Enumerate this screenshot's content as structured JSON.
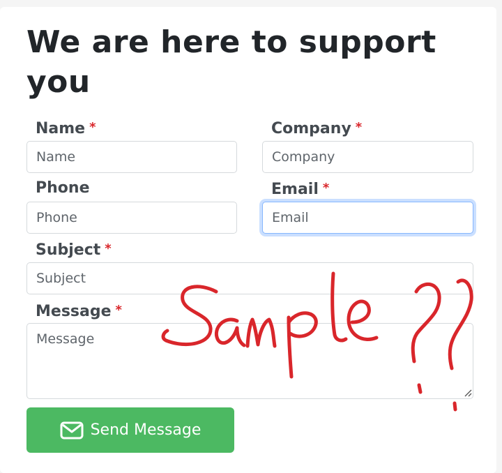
{
  "form": {
    "title": "We are here to support you",
    "required_mark": "*",
    "fields": {
      "name": {
        "label": "Name",
        "placeholder": "Name",
        "required": true
      },
      "company": {
        "label": "Company",
        "placeholder": "Company",
        "required": true
      },
      "phone": {
        "label": "Phone",
        "placeholder": "Phone",
        "required": false
      },
      "email": {
        "label": "Email",
        "placeholder": "Email",
        "required": true,
        "focused": true
      },
      "subject": {
        "label": "Subject",
        "placeholder": "Subject",
        "required": true
      },
      "message": {
        "label": "Message",
        "placeholder": "Message",
        "required": true
      }
    },
    "submit": {
      "label": "Send Message",
      "icon": "envelope-icon"
    }
  },
  "annotation": {
    "text": "Sample ??",
    "color": "#d9262b"
  },
  "colors": {
    "required": "#d9262b",
    "button": "#4cb962",
    "focus_ring": "#86b7fe"
  }
}
